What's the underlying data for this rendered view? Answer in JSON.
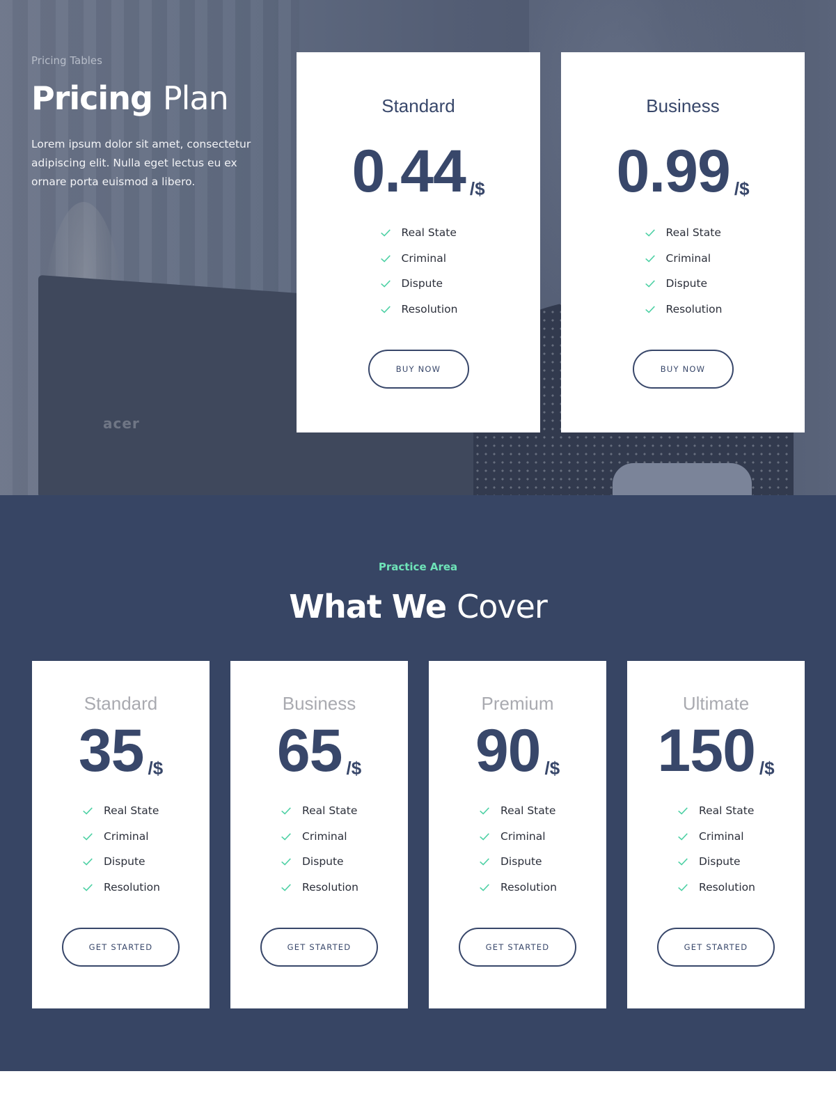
{
  "hero": {
    "eyebrow": "Pricing Tables",
    "title_bold": "Pricing",
    "title_light": "Plan",
    "description": "Lorem ipsum dolor sit amet, consectetur adipiscing elit. Nulla eget lectus eu ex ornare porta euismod a libero.",
    "background_logo": "acer",
    "cards": [
      {
        "name": "Standard",
        "price": "0.44",
        "unit": "/$",
        "features": [
          "Real State",
          "Criminal",
          "Dispute",
          "Resolution"
        ],
        "button": "BUY NOW"
      },
      {
        "name": "Business",
        "price": "0.99",
        "unit": "/$",
        "features": [
          "Real State",
          "Criminal",
          "Dispute",
          "Resolution"
        ],
        "button": "BUY NOW"
      }
    ]
  },
  "cover": {
    "eyebrow": "Practice Area",
    "title_bold": "What We",
    "title_light": "Cover",
    "plans": [
      {
        "name": "Standard",
        "price": "35",
        "unit": "/$",
        "features": [
          "Real State",
          "Criminal",
          "Dispute",
          "Resolution"
        ],
        "button": "GET STARTED"
      },
      {
        "name": "Business",
        "price": "65",
        "unit": "/$",
        "features": [
          "Real State",
          "Criminal",
          "Dispute",
          "Resolution"
        ],
        "button": "GET STARTED"
      },
      {
        "name": "Premium",
        "price": "90",
        "unit": "/$",
        "features": [
          "Real State",
          "Criminal",
          "Dispute",
          "Resolution"
        ],
        "button": "GET STARTED"
      },
      {
        "name": "Ultimate",
        "price": "150",
        "unit": "/$",
        "features": [
          "Real State",
          "Criminal",
          "Dispute",
          "Resolution"
        ],
        "button": "GET STARTED"
      }
    ]
  },
  "icons": {
    "feature": "check-icon"
  },
  "colors": {
    "primary": "#38476a",
    "section_bg": "#374564",
    "accent": "#6ee3b8",
    "check": "#4fd1a5"
  }
}
